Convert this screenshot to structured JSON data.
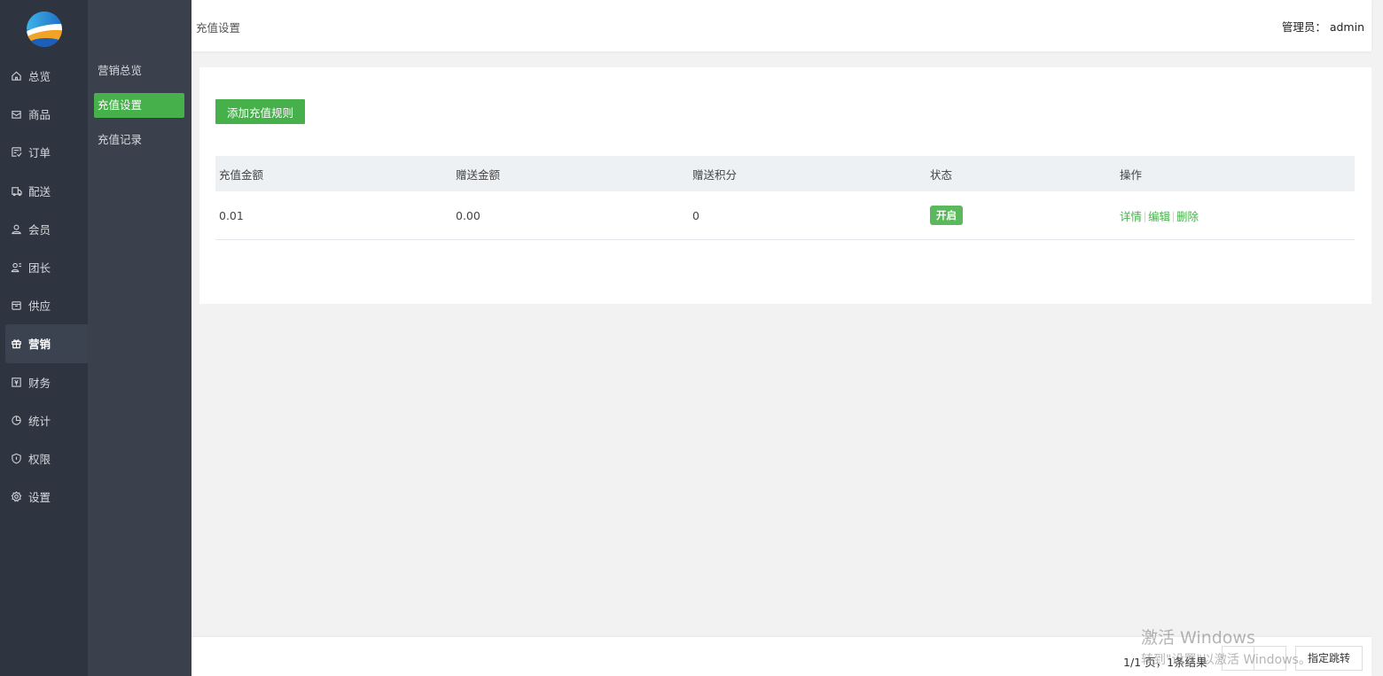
{
  "sidebar": {
    "items": [
      {
        "label": "总览",
        "icon": "home-icon"
      },
      {
        "label": "商品",
        "icon": "goods-icon"
      },
      {
        "label": "订单",
        "icon": "order-icon"
      },
      {
        "label": "配送",
        "icon": "delivery-icon"
      },
      {
        "label": "会员",
        "icon": "member-icon"
      },
      {
        "label": "团长",
        "icon": "leader-icon"
      },
      {
        "label": "供应",
        "icon": "supply-icon"
      },
      {
        "label": "营销",
        "icon": "gift-icon"
      },
      {
        "label": "财务",
        "icon": "finance-icon"
      },
      {
        "label": "统计",
        "icon": "pie-chart-icon"
      },
      {
        "label": "权限",
        "icon": "shield-icon"
      },
      {
        "label": "设置",
        "icon": "gear-icon"
      }
    ]
  },
  "subnav": {
    "items": [
      {
        "label": "营销总览"
      },
      {
        "label": "充值设置"
      },
      {
        "label": "充值记录"
      }
    ]
  },
  "header": {
    "breadcrumb": "充值设置",
    "admin": "管理员： admin"
  },
  "main": {
    "add_button": "添加充值规则",
    "table": {
      "headers": [
        "充值金额",
        "赠送金额",
        "赠送积分",
        "状态",
        "操作"
      ],
      "rows": [
        {
          "amount": "0.01",
          "bonus": "0.00",
          "points": "0",
          "status": "开启",
          "actions": [
            "详情",
            "编辑",
            "删除"
          ]
        }
      ]
    }
  },
  "pager": {
    "info": "1/1 页，1条结果",
    "jump_label": "指定跳转"
  },
  "watermark": {
    "line1": "激活 Windows",
    "line2": "转到\"设置\"以激活 Windows。"
  },
  "colors": {
    "accent": "#46b04a",
    "sidebar_bg": "#2f3540",
    "subnav_bg": "#3a414d"
  }
}
